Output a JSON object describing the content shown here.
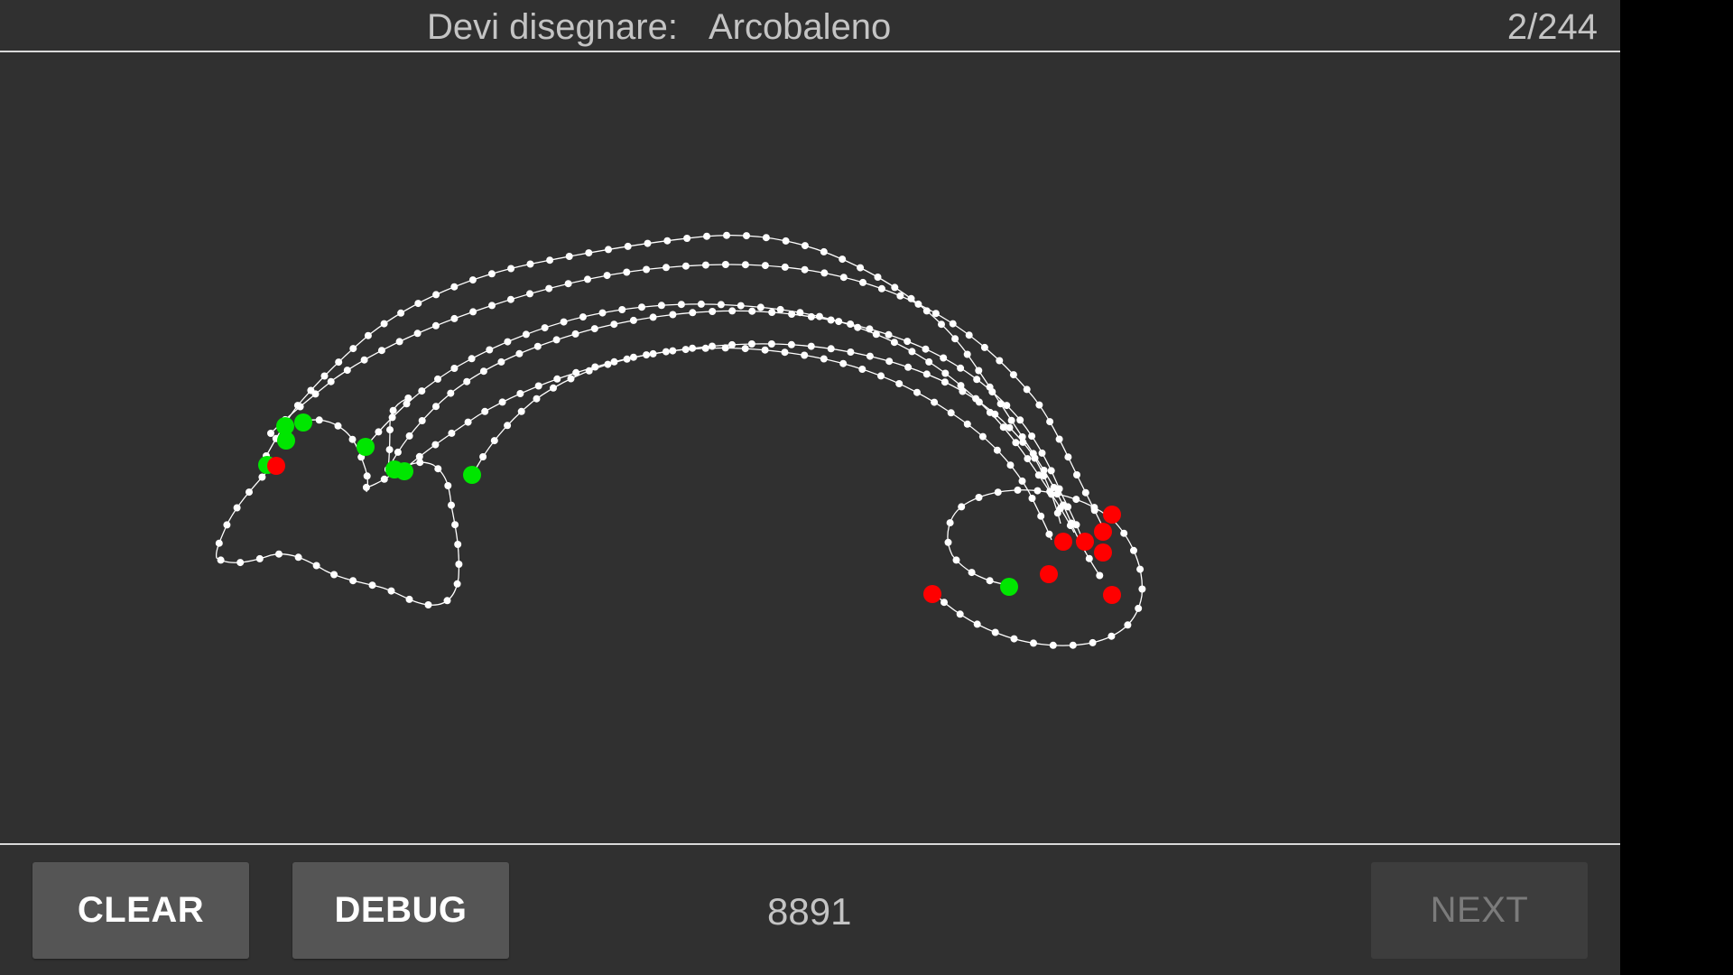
{
  "header": {
    "prompt_label": "Devi disegnare:",
    "word": "Arcobaleno",
    "progress": "2/244"
  },
  "toolbar": {
    "clear_label": "CLEAR",
    "debug_label": "DEBUG",
    "score": "8891",
    "next_label": "NEXT",
    "next_enabled": false
  },
  "colors": {
    "background": "#303030",
    "divider": "#d9d9d9",
    "stroke": "#ffffff",
    "stroke_start": "#00e600",
    "stroke_end": "#ff0000",
    "button": "#555555",
    "button_disabled": "#3d3d3d"
  }
}
